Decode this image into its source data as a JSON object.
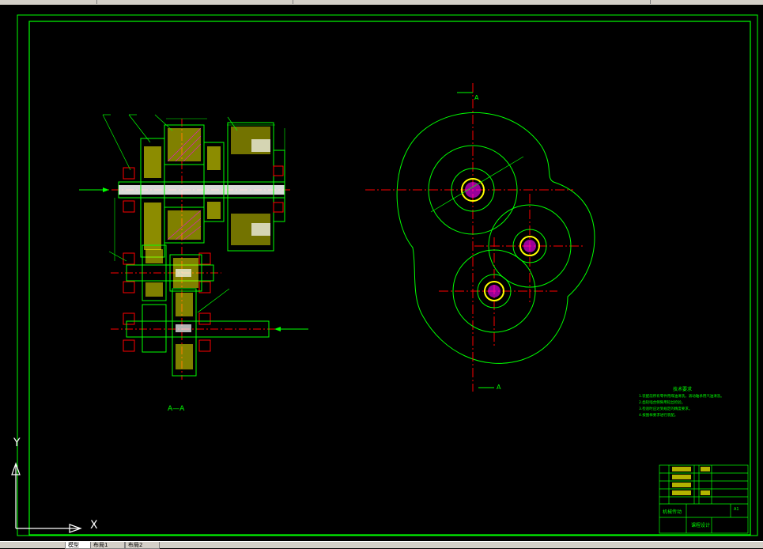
{
  "section_label": "A—A",
  "view_label_top": "A",
  "view_label_bottom": "A",
  "tech_requirements": {
    "title": "技术要求",
    "lines": [
      "1.装配前所有零件用煤油清洗，滚动轴承用汽油清洗。",
      "2.齿轮啮合侧隙用铅丝检验。",
      "3.检验时应达到规定的精度要求。",
      "4.按图样要求进行装配。"
    ]
  },
  "title_block": {
    "company": "机械传动",
    "design_name": "课程设计",
    "sheet_label": "A1"
  },
  "ucs": {
    "x_label": "X",
    "y_label": "Y"
  },
  "tabs": [
    "模型",
    "布局1",
    "布局2"
  ],
  "colors": {
    "green": "#00ff00",
    "red": "#ff0000",
    "yellow": "#ffff00",
    "white": "#ffffff",
    "magenta": "#ff00ff",
    "cyan": "#00ffff"
  }
}
